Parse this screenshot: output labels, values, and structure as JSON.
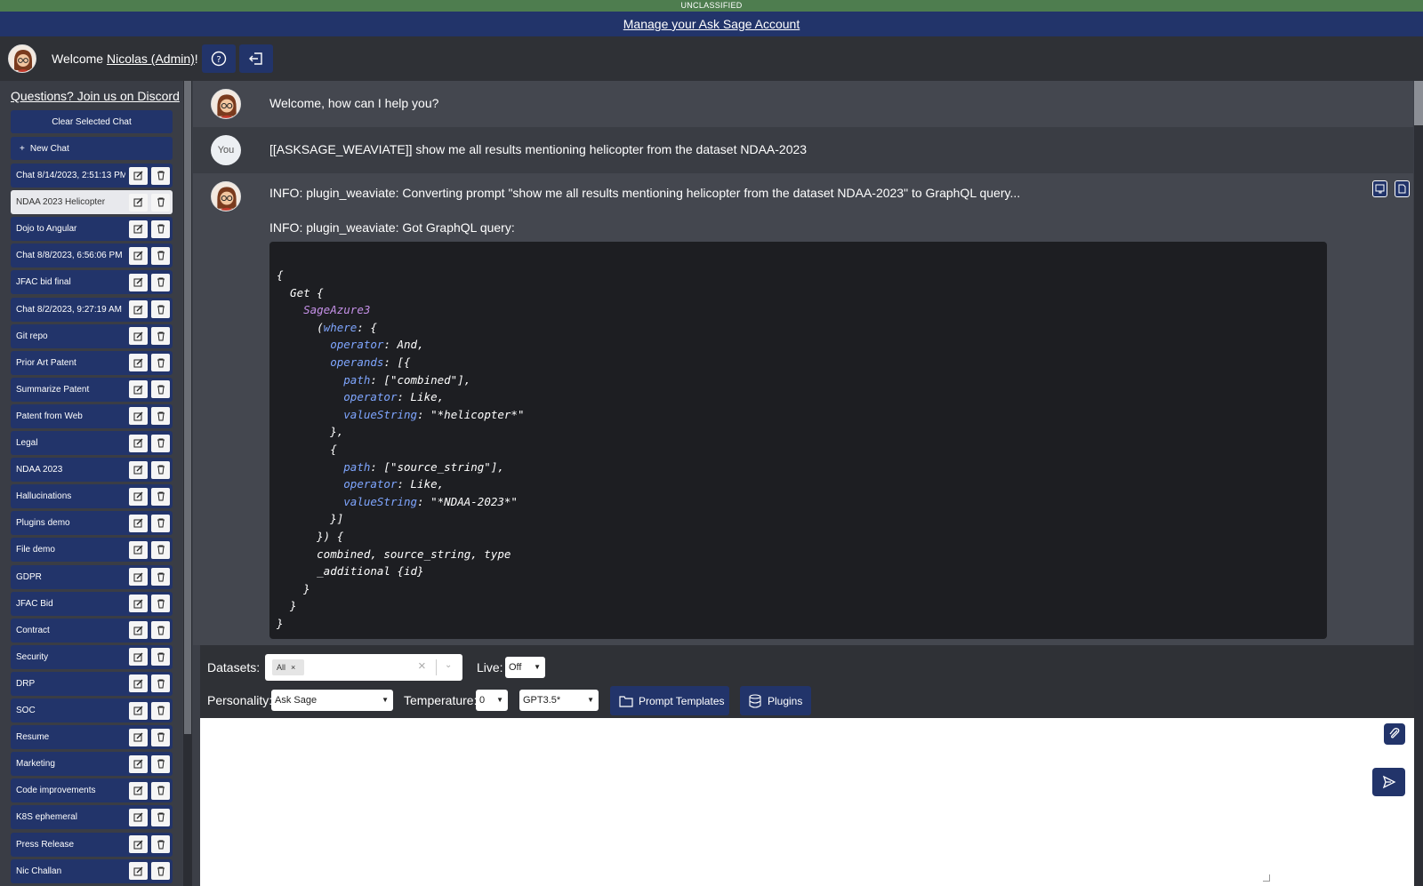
{
  "banner": {
    "classification": "UNCLASSIFIED",
    "manage_link": "Manage your Ask Sage Account"
  },
  "header": {
    "welcome_prefix": "Welcome ",
    "username": "Nicolas (Admin)",
    "welcome_suffix": "!"
  },
  "sidebar": {
    "discord_link": "Questions? Join us on Discord",
    "clear_label": "Clear Selected Chat",
    "new_chat_label": "New Chat",
    "chats": [
      "Chat 8/14/2023, 2:51:13 PM",
      "NDAA 2023 Helicopter",
      "Dojo to Angular",
      "Chat 8/8/2023, 6:56:06 PM",
      "JFAC bid final",
      "Chat 8/2/2023, 9:27:19 AM",
      "Git repo",
      "Prior Art Patent",
      "Summarize Patent",
      "Patent from Web",
      "Legal",
      "NDAA 2023",
      "Hallucinations",
      "Plugins demo",
      "File demo",
      "GDPR",
      "JFAC Bid",
      "Contract",
      "Security",
      "DRP",
      "SOC",
      "Resume",
      "Marketing",
      "Code improvements",
      "K8S ephemeral",
      "Press Release",
      "Nic Challan"
    ],
    "active_index": 1
  },
  "messages": {
    "welcome": "Welcome, how can I help you?",
    "user_label": "You",
    "user_prompt": "[[ASKSAGE_WEAVIATE]] show me all results mentioning helicopter from the dataset NDAA-2023",
    "info1": "INFO: plugin_weaviate: Converting prompt \"show me all results mentioning helicopter from the dataset NDAA-2023\" to GraphQL query...",
    "info2": "INFO: plugin_weaviate: Got GraphQL query:"
  },
  "code_lines": [
    "{",
    "  Get {",
    "    SageAzure3",
    "      (where: {",
    "        operator: And,",
    "        operands: [{",
    "          path: [\"combined\"],",
    "          operator: Like,",
    "          valueString: \"*helicopter*\"",
    "        },",
    "        {",
    "          path: [\"source_string\"],",
    "          operator: Like,",
    "          valueString: \"*NDAA-2023*\"",
    "        }]",
    "      }) {",
    "      combined, source_string, type",
    "      _additional {id}",
    "    }",
    "  }",
    "}"
  ],
  "controls": {
    "datasets_label": "Datasets:",
    "dataset_chip": "All",
    "live_label": "Live:",
    "live_value": "Off",
    "personality_label": "Personality:",
    "personality_value": "Ask Sage",
    "temperature_label": "Temperature:",
    "temperature_value": "0",
    "model_value": "GPT3.5*",
    "prompt_templates_label": "Prompt Templates",
    "plugins_label": "Plugins"
  },
  "colors": {
    "navy": "#22346a",
    "banner_green": "#4e7d4f",
    "bg": "#3c3f47"
  }
}
